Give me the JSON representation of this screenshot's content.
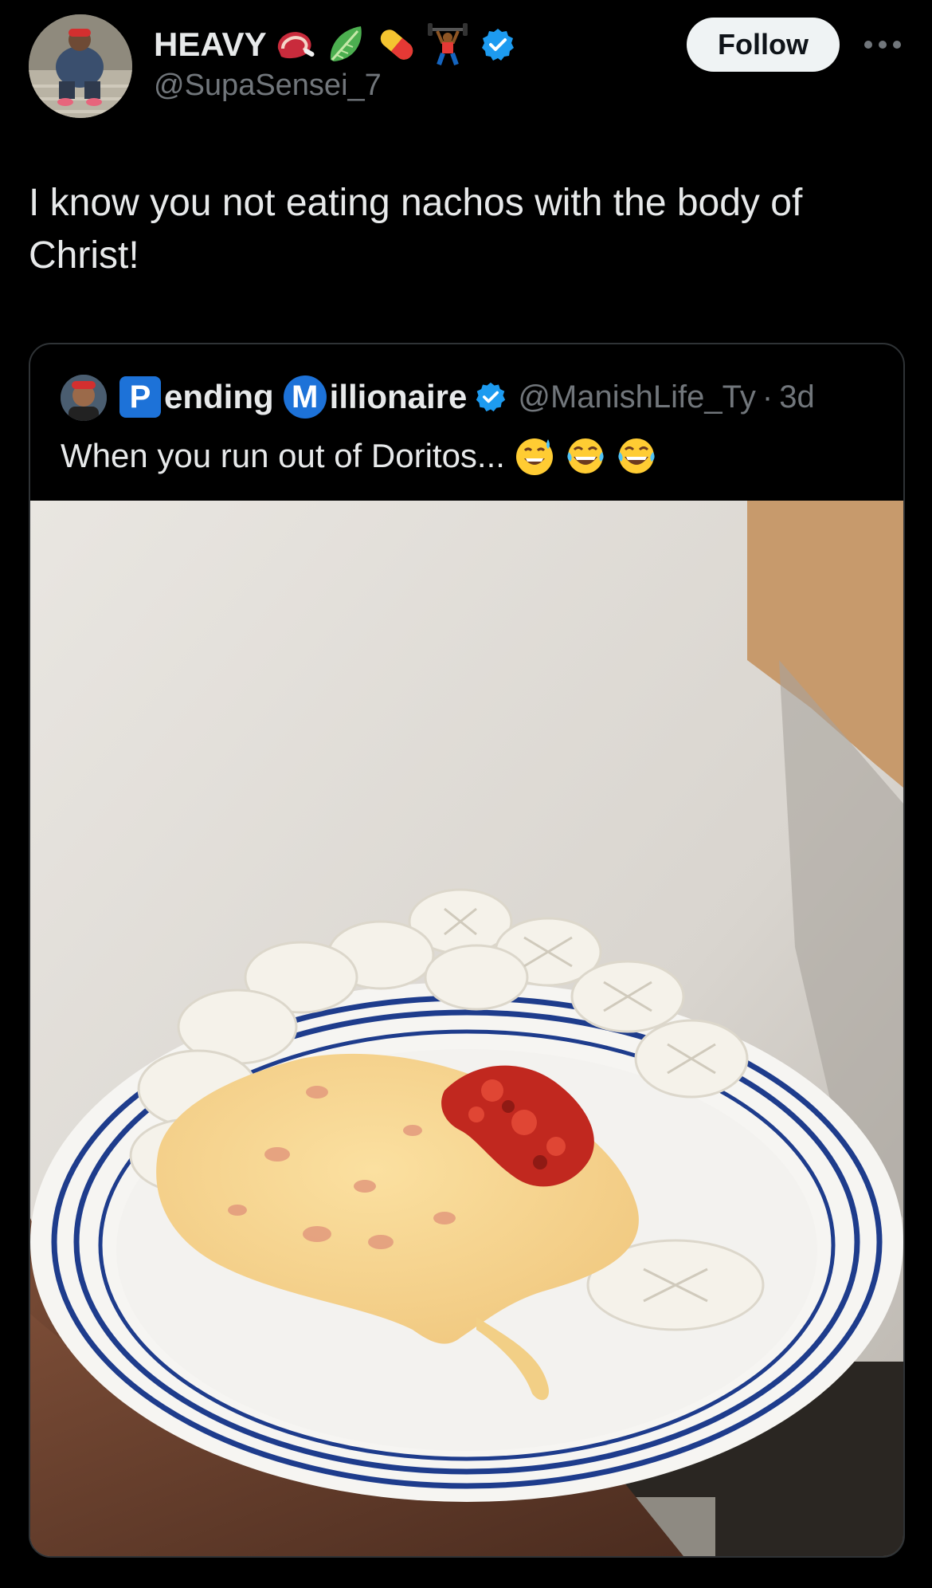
{
  "author": {
    "display_name": "HEAVY",
    "handle": "@SupaSensei_7",
    "name_emojis": [
      "steak-icon",
      "lettuce-icon",
      "pill-icon",
      "weightlifter-icon"
    ],
    "verified": true
  },
  "actions": {
    "follow_label": "Follow",
    "more_icon": "more-horizontal-icon"
  },
  "tweet": {
    "text": "I know you not eating nachos with the body of Christ!"
  },
  "quoted": {
    "name_p_letter": "P",
    "name_part1": "ending",
    "name_m_letter": "M",
    "name_part2": "illionaire",
    "verified": true,
    "handle": "@ManishLife_Ty",
    "separator": "·",
    "time": "3d",
    "text": "When you run out of Doritos...",
    "text_emojis": [
      "grinning-sweat-icon",
      "tears-of-joy-icon",
      "tears-of-joy-icon"
    ],
    "media_icon": "photo-communion-wafers-queso-plate"
  },
  "colors": {
    "background": "#000000",
    "text_primary": "#e7e9ea",
    "text_secondary": "#71767b",
    "verified_blue": "#1d9bf0",
    "follow_bg": "#eff3f4",
    "card_border": "#2f3336"
  }
}
